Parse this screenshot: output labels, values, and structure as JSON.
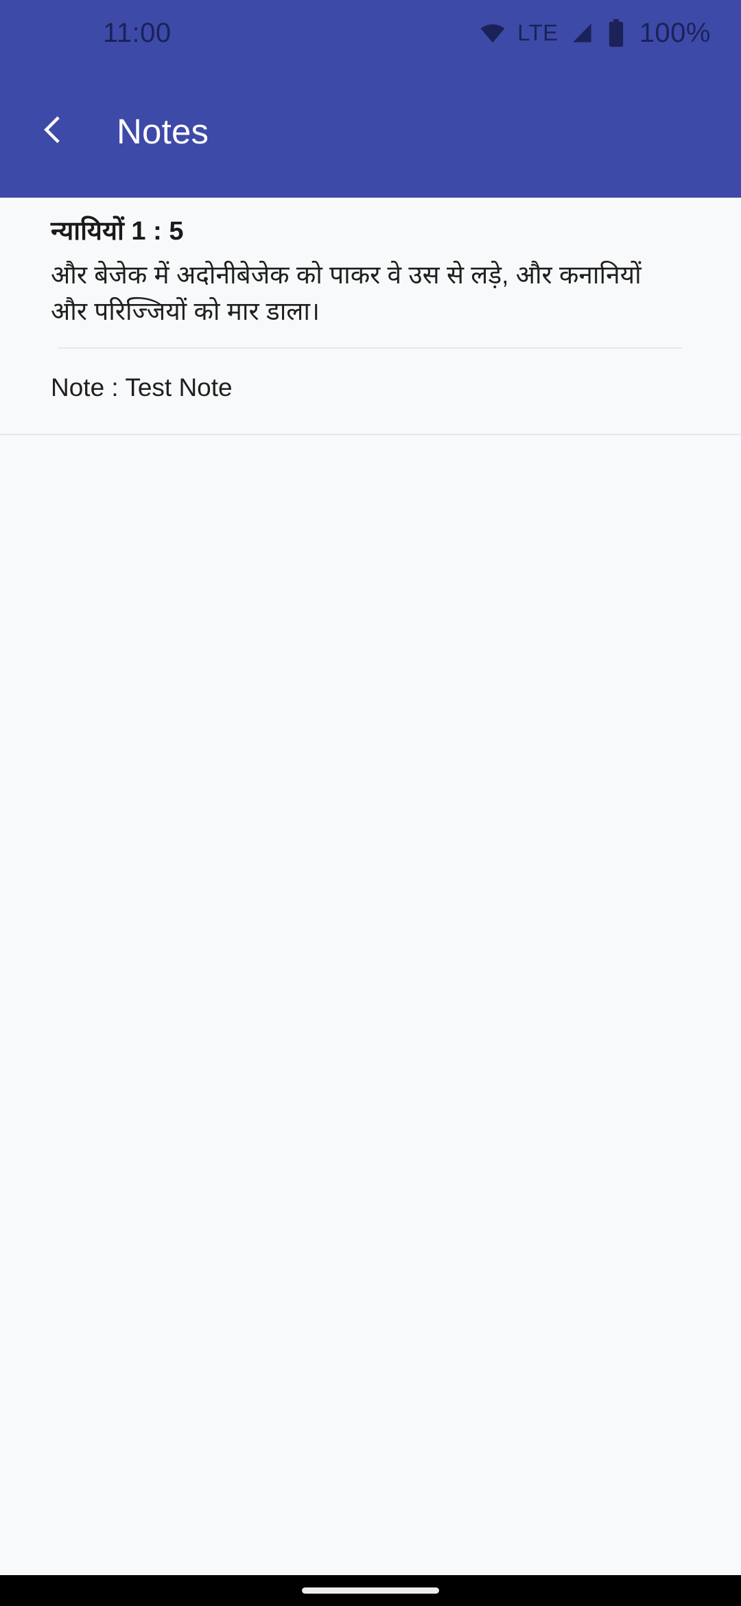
{
  "status_bar": {
    "clock": "11:00",
    "network_label": "LTE",
    "battery_percent": "100%",
    "icons": [
      "wifi-icon",
      "signal-icon",
      "battery-icon"
    ],
    "background_color": "#3E4AA8",
    "foreground_color": "#1B2259"
  },
  "app_bar": {
    "back_label": "back-arrow",
    "title": "Notes",
    "background_color": "#3E4AA8",
    "title_color": "#FFFFFF"
  },
  "note": {
    "reference": "न्यायियों 1 : 5",
    "verse_text": "और बेजेक में अदोनीबेजेक को पाकर वे उस से लड़े, और कनानियों और परिज्जियों को मार डाला।",
    "note_text": "Note : Test Note"
  },
  "nav_bar": {
    "gesture_pill": "home-indicator",
    "background_color": "#000000"
  }
}
